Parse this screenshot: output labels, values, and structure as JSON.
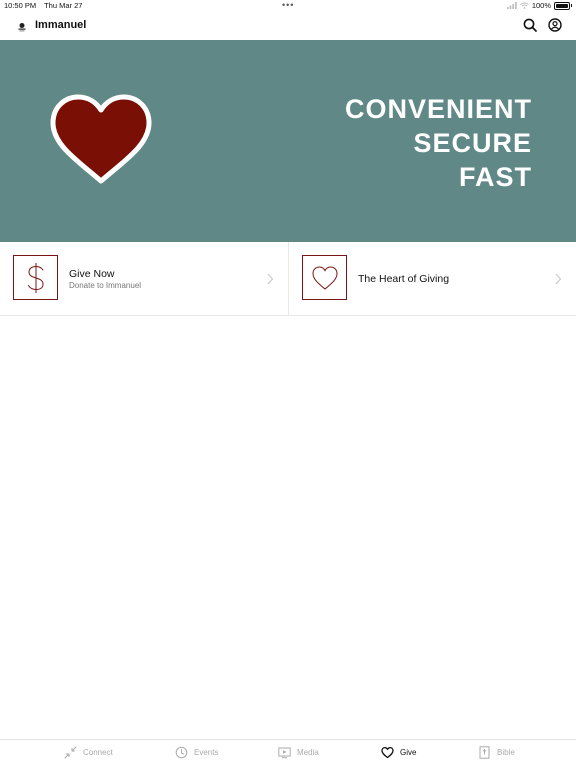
{
  "status_bar": {
    "time": "10:50 PM",
    "date": "Thu Mar 27",
    "dots": "•••",
    "battery": "100%"
  },
  "header": {
    "title": "Immanuel",
    "icons": [
      "search-icon",
      "account-icon"
    ]
  },
  "hero": {
    "background_color": "#5f8886",
    "heart_color": "#7a1005",
    "lines": [
      "CONVENIENT",
      "SECURE",
      "FAST"
    ]
  },
  "cards": [
    {
      "title": "Give Now",
      "subtitle": "Donate to Immanuel",
      "icon": "dollar-icon"
    },
    {
      "title": "The Heart of Giving",
      "icon": "heart-outline-icon"
    }
  ],
  "tabs": [
    {
      "label": "Connect",
      "icon": "connect-icon",
      "active": false
    },
    {
      "label": "Events",
      "icon": "clock-icon",
      "active": false
    },
    {
      "label": "Media",
      "icon": "media-icon",
      "active": false
    },
    {
      "label": "Give",
      "icon": "heart-icon",
      "active": true
    },
    {
      "label": "Bible",
      "icon": "bible-icon",
      "active": false
    }
  ]
}
